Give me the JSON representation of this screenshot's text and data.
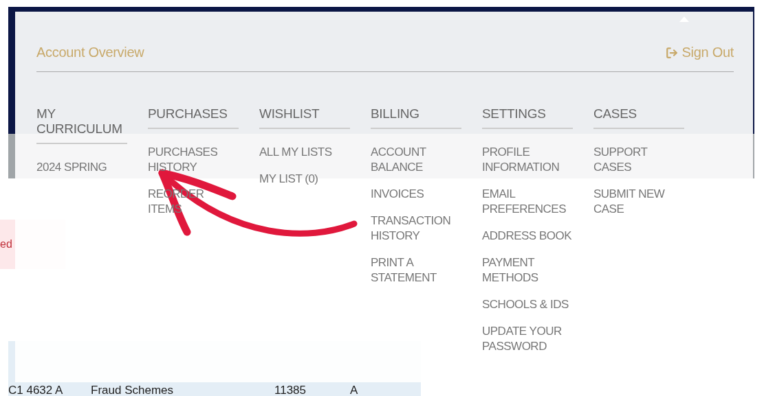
{
  "background": {
    "notice": "ed",
    "table": {
      "rows": [
        {
          "course": "C1 4632 A",
          "description": "Fraud Schemes",
          "class": "11385",
          "section": "A"
        }
      ]
    }
  },
  "account_menu": {
    "title": "Account Overview",
    "sign_out": "Sign Out",
    "columns": [
      {
        "heading": "MY CURRICULUM",
        "items": [
          "2024 SPRING"
        ]
      },
      {
        "heading": "PURCHASES",
        "items": [
          "PURCHASES HISTORY",
          "REORDER ITEMS"
        ]
      },
      {
        "heading": "WISHLIST",
        "items": [
          "ALL MY LISTS",
          "MY LIST (0)"
        ]
      },
      {
        "heading": "BILLING",
        "items": [
          "ACCOUNT BALANCE",
          "INVOICES",
          "TRANSACTION HISTORY",
          "PRINT A STATEMENT"
        ]
      },
      {
        "heading": "SETTINGS",
        "items": [
          "PROFILE INFORMATION",
          "EMAIL PREFERENCES",
          "ADDRESS BOOK",
          "PAYMENT METHODS",
          "SCHOOLS & IDS",
          "UPDATE YOUR PASSWORD"
        ]
      },
      {
        "heading": "CASES",
        "items": [
          "SUPPORT CASES",
          "SUBMIT NEW CASE"
        ]
      }
    ]
  }
}
